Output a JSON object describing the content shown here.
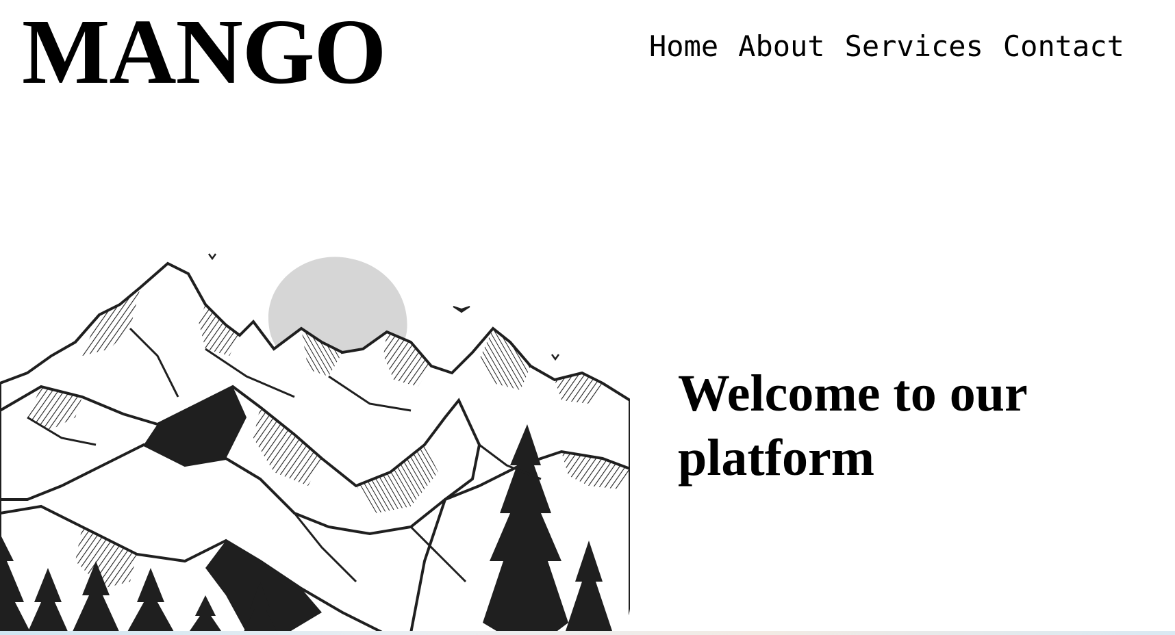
{
  "brand": {
    "logo_text": "MANGO"
  },
  "nav": {
    "items": [
      {
        "label": "Home"
      },
      {
        "label": "About"
      },
      {
        "label": "Services"
      },
      {
        "label": "Contact"
      }
    ]
  },
  "hero": {
    "headline": "Welcome to our platform",
    "illustration": "mountain-landscape-ink-illustration",
    "sun_color": "#d6d6d6",
    "ink_color": "#1f1f1f"
  }
}
